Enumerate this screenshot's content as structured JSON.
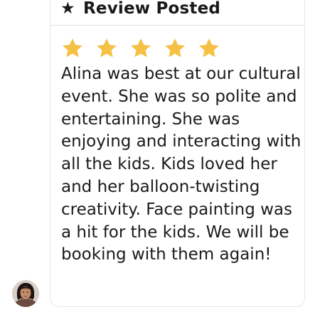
{
  "review": {
    "header": {
      "title": "Review Posted",
      "icon": "star-icon"
    },
    "rating": {
      "value": 5,
      "max": 5,
      "star_color": "#F5C043"
    },
    "text": "Alina was best at our cultural event. She was so polite and entertaining. She was enjoying and interacting with all the kids. Kids loved her and her balloon-twisting creativity. Face painting was a hit for the kids. We will be booking with them again!"
  },
  "reviewer": {
    "avatar": "reviewer-avatar"
  }
}
